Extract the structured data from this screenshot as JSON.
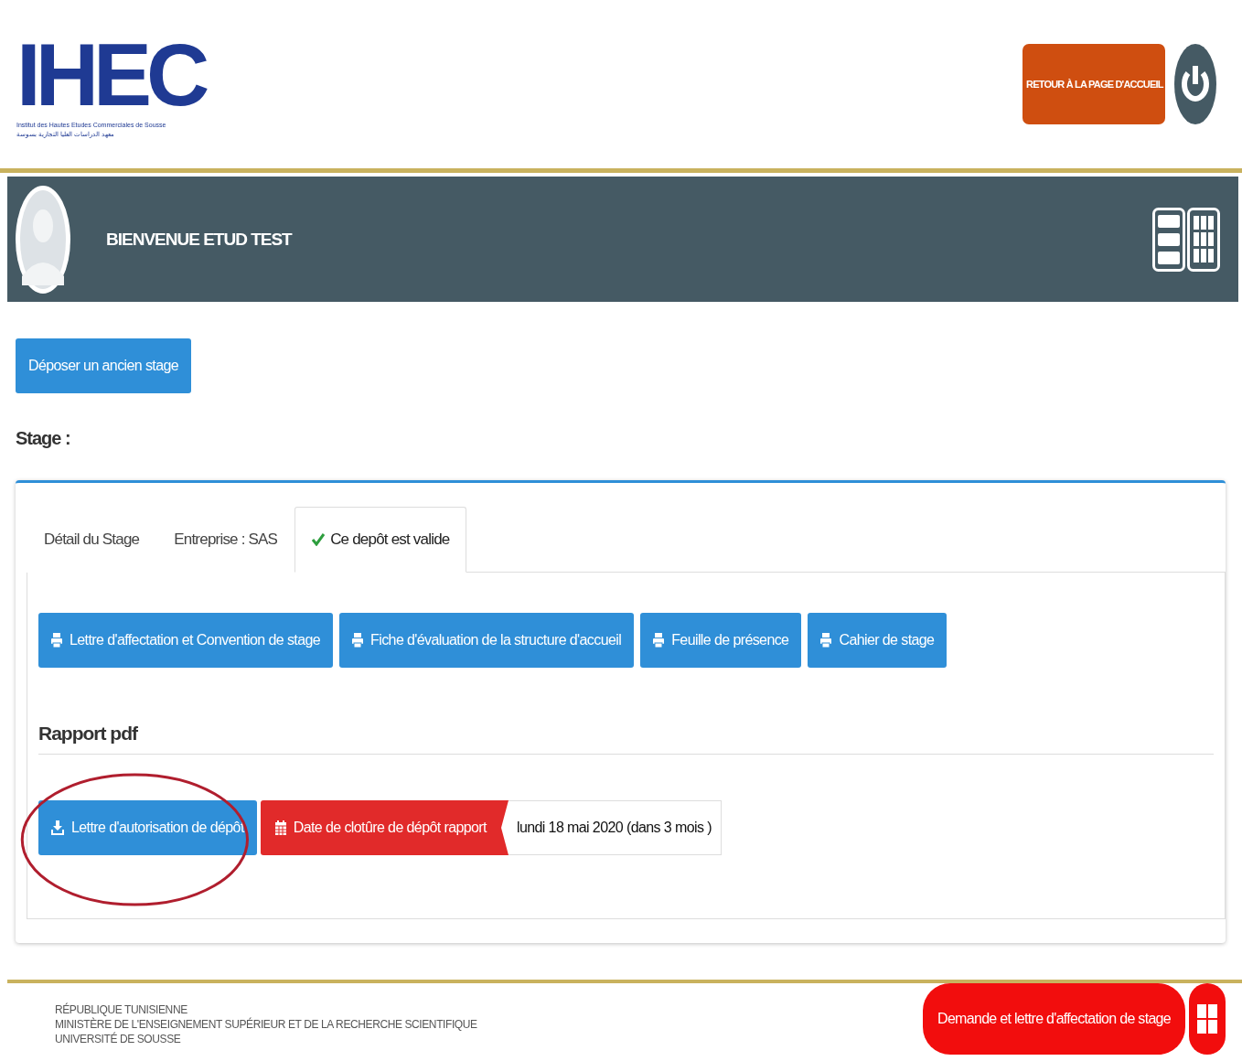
{
  "header": {
    "logo": {
      "mark": "IHEC",
      "line_fr": "Institut des Hautes Etudes Commerciales de Sousse",
      "line_ar": "معهد الدراسات العليا التجارية بسوسة"
    },
    "home_button": "RETOUR À LA PAGE D'ACCUEIL"
  },
  "welcome": {
    "text": "BIENVENUE ETUD TEST"
  },
  "deposit_button": "Déposer un ancien stage",
  "section_label": "Stage :",
  "tabs": [
    {
      "label": "Détail du Stage",
      "selected": false,
      "kind": "plain"
    },
    {
      "label": "Entreprise : SAS",
      "selected": false,
      "kind": "plain"
    },
    {
      "label": "Ce depôt est valide",
      "selected": true,
      "kind": "validated"
    }
  ],
  "print_buttons": [
    "Lettre d'affectation et Convention de stage",
    "Fiche d'évaluation de la structure d'accueil",
    "Feuille de présence",
    "Cahier de stage"
  ],
  "report": {
    "title": "Rapport pdf",
    "download_button": "Lettre d'autorisation de dépôt",
    "deadline": {
      "label": "Date de clotûre de dépôt rapport",
      "value": "lundi 18 mai 2020 (dans 3 mois )"
    }
  },
  "footer": {
    "lines": [
      "RÉPUBLIQUE TUNISIENNE",
      "MINISTÈRE DE L'ENSEIGNEMENT SUPÉRIEUR ET DE LA RECHERCHE SCIENTIFIQUE",
      "UNIVERSITÉ DE SOUSSE"
    ],
    "request_button": "Demande et lettre d'affectation de stage"
  }
}
